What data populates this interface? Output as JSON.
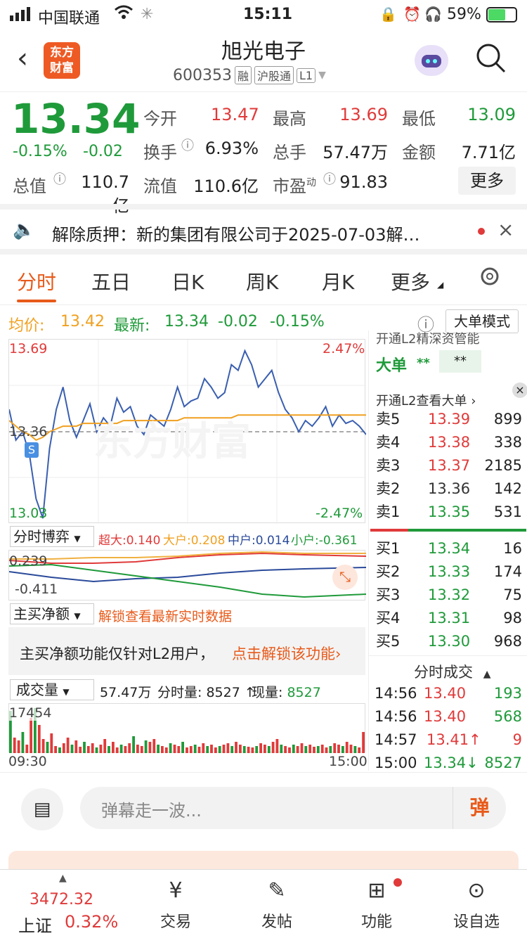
{
  "status_bar": {
    "carrier": "中国联通",
    "time": "15:11",
    "battery": "59%"
  },
  "header": {
    "logo_line1": "东方",
    "logo_line2": "财富",
    "title": "旭光电子",
    "code": "600353",
    "tags": [
      "融",
      "沪股通",
      "L1"
    ]
  },
  "quote": {
    "price": "13.34",
    "change_pct": "-0.15%",
    "change": "-0.02",
    "open_label": "今开",
    "open": "13.47",
    "high_label": "最高",
    "high": "13.69",
    "low_label": "最低",
    "low": "13.09",
    "turnover_label": "换手",
    "turnover": "6.93%",
    "volume_label": "总手",
    "volume": "57.47万",
    "amount_label": "金额",
    "amount": "7.71亿",
    "mktcap_label": "总值",
    "mktcap": "110.7亿",
    "float_label": "流值",
    "float": "110.6亿",
    "pe_label": "市盈",
    "pe_sup": "动",
    "pe": "91.83",
    "more_label": "更多"
  },
  "notice": {
    "text": "解除质押：新的集团有限公司于2025-07-03解…"
  },
  "tabs": [
    "分时",
    "五日",
    "日K",
    "周K",
    "月K",
    "更多"
  ],
  "avg_row": {
    "avg_label": "均价:",
    "avg": "13.42",
    "latest_label": "最新:",
    "latest": "13.34",
    "change": "-0.02",
    "pct": "-0.15%",
    "mode_label": "大单模式"
  },
  "chart": {
    "y_top": "13.69",
    "y_mid": "13.36",
    "y_bottom": "13.03",
    "pct_top": "2.47%",
    "pct_bottom": "-2.47%",
    "watermark": "东方财富",
    "marker": "S",
    "time_start": "09:30",
    "time_end": "15:00"
  },
  "chart_data": {
    "type": "line",
    "title": "",
    "ylim": [
      13.03,
      13.69
    ],
    "prev_close": 13.36,
    "series": [
      {
        "name": "",
        "values": [
          13.44,
          13.33,
          13.36,
          13.28,
          13.12,
          13.05,
          13.3,
          13.44,
          13.52,
          13.4,
          13.34,
          13.4,
          13.46,
          13.36,
          13.41,
          13.38,
          13.48,
          13.43,
          13.45,
          13.38,
          13.35,
          13.42,
          13.4,
          13.38,
          13.44,
          13.52,
          13.45,
          13.47,
          13.48,
          13.55,
          13.52,
          13.48,
          13.5,
          13.6,
          13.58,
          13.65,
          13.6,
          13.52,
          13.55,
          13.58,
          13.5,
          13.44,
          13.41,
          13.36,
          13.4,
          13.38,
          13.41,
          13.45,
          13.38,
          13.42,
          13.39,
          13.4,
          13.38,
          13.35
        ]
      },
      {
        "name": "",
        "values": [
          13.4,
          13.38,
          13.36,
          13.35,
          13.33,
          13.34,
          13.36,
          13.37,
          13.38,
          13.38,
          13.38,
          13.39,
          13.39,
          13.39,
          13.39,
          13.39,
          13.39,
          13.4,
          13.4,
          13.4,
          13.4,
          13.4,
          13.4,
          13.4,
          13.4,
          13.4,
          13.41,
          13.41,
          13.41,
          13.41,
          13.41,
          13.41,
          13.41,
          13.41,
          13.42,
          13.42,
          13.42,
          13.42,
          13.42,
          13.42,
          13.42,
          13.42,
          13.42,
          13.42,
          13.42,
          13.42,
          13.42,
          13.42,
          13.42,
          13.42,
          13.42,
          13.42,
          13.42,
          13.42
        ]
      }
    ]
  },
  "boyi": {
    "label": "分时博弈",
    "super_label": "超大:",
    "super": "0.140",
    "big_label": "大户:",
    "big": "0.208",
    "mid_label": "中户:",
    "mid": "0.014",
    "small_label": "小户:",
    "small": "-0.361",
    "y_top": "0.239",
    "y_bottom": "-0.411"
  },
  "net_buy": {
    "label": "主买净额",
    "unlock": "解锁查看最新实时数据",
    "info": "主买净额功能仅针对L2用户，",
    "info_link": "点击解锁该功能"
  },
  "volume_panel": {
    "label": "成交量",
    "total": "57.47万",
    "fen_label": "分时量:",
    "fen": "8527",
    "now_label": "现量:",
    "now": "8527",
    "y_top": "17454"
  },
  "side": {
    "top_text": "开通L2精深资管能",
    "dadan": "大单",
    "stars1": "**",
    "stars2": "**",
    "l2_text": "开通L2查看大单",
    "sell": [
      {
        "label": "卖5",
        "price": "13.39",
        "vol": "899"
      },
      {
        "label": "卖4",
        "price": "13.38",
        "vol": "338"
      },
      {
        "label": "卖3",
        "price": "13.37",
        "vol": "2185"
      },
      {
        "label": "卖2",
        "price": "13.36",
        "vol": "142"
      },
      {
        "label": "卖1",
        "price": "13.35",
        "vol": "531"
      }
    ],
    "buy": [
      {
        "label": "买1",
        "price": "13.34",
        "vol": "16"
      },
      {
        "label": "买2",
        "price": "13.33",
        "vol": "174"
      },
      {
        "label": "买3",
        "price": "13.32",
        "vol": "75"
      },
      {
        "label": "买4",
        "price": "13.31",
        "vol": "98"
      },
      {
        "label": "买5",
        "price": "13.30",
        "vol": "968"
      }
    ],
    "ticks_title": "分时成交",
    "ticks": [
      {
        "time": "14:56",
        "price": "13.40",
        "vol": "193"
      },
      {
        "time": "14:56",
        "price": "13.40",
        "vol": "568"
      },
      {
        "time": "14:57",
        "price": "13.41",
        "vol": "9"
      },
      {
        "time": "15:00",
        "price": "13.34",
        "vol": "8527"
      }
    ]
  },
  "comment": {
    "placeholder": "弹幕走一波...",
    "danmu": "弹"
  },
  "tabbar": {
    "index_value": "3472.32",
    "index_name": "上证",
    "index_pct": "0.32%",
    "items": [
      "交易",
      "发帖",
      "功能",
      "设自选"
    ]
  }
}
